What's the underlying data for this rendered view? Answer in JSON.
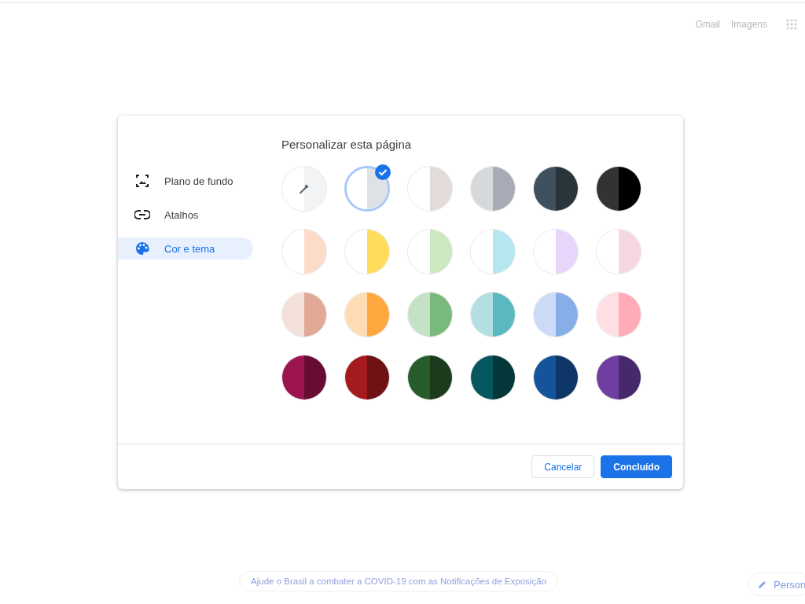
{
  "top_links": [
    "Gmail",
    "Imagens"
  ],
  "dialog": {
    "sidebar": [
      {
        "label": "Plano de fundo",
        "selected": false
      },
      {
        "label": "Atalhos",
        "selected": false
      },
      {
        "label": "Cor e tema",
        "selected": true
      }
    ],
    "title": "Personalizar esta página",
    "swatches": [
      {
        "kind": "picker",
        "halves": [
          {
            "color": "#ffffff"
          },
          {
            "color": "#f1f3f4"
          }
        ],
        "selected": false
      },
      {
        "kind": "swatch",
        "halves": [
          {
            "color": "#ffffff"
          },
          {
            "color": "#dee1e5"
          }
        ],
        "selected": true
      },
      {
        "kind": "swatch",
        "halves": [
          {
            "color": "#ffffff"
          },
          {
            "color": "#e3dcd9"
          }
        ],
        "selected": false
      },
      {
        "kind": "swatch",
        "halves": [
          {
            "color": "#d6d8dc"
          },
          {
            "color": "#a8abb5"
          }
        ],
        "selected": false
      },
      {
        "kind": "swatch",
        "halves": [
          {
            "color": "#3f515c"
          },
          {
            "color": "#29343b"
          }
        ],
        "selected": false
      },
      {
        "kind": "swatch",
        "halves": [
          {
            "color": "#333333"
          },
          {
            "color": "#000000"
          }
        ],
        "selected": false
      },
      {
        "kind": "swatch",
        "halves": [
          {
            "color": "#ffffff"
          },
          {
            "color": "#fcdbc9"
          }
        ],
        "selected": false
      },
      {
        "kind": "swatch",
        "halves": [
          {
            "color": "#ffffff"
          },
          {
            "color": "#ffdd5c"
          }
        ],
        "selected": false
      },
      {
        "kind": "swatch",
        "halves": [
          {
            "color": "#ffffff"
          },
          {
            "color": "#cce8c1"
          }
        ],
        "selected": false
      },
      {
        "kind": "swatch",
        "halves": [
          {
            "color": "#ffffff"
          },
          {
            "color": "#b5e7f0"
          }
        ],
        "selected": false
      },
      {
        "kind": "swatch",
        "halves": [
          {
            "color": "#ffffff"
          },
          {
            "color": "#e7d5fb"
          }
        ],
        "selected": false
      },
      {
        "kind": "swatch",
        "halves": [
          {
            "color": "#ffffff"
          },
          {
            "color": "#f6d6e2"
          }
        ],
        "selected": false
      },
      {
        "kind": "swatch",
        "halves": [
          {
            "color": "#f3e0da"
          },
          {
            "color": "#e2a997"
          }
        ],
        "selected": false
      },
      {
        "kind": "swatch",
        "halves": [
          {
            "color": "#ffdcb4"
          },
          {
            "color": "#ffa83f"
          }
        ],
        "selected": false
      },
      {
        "kind": "swatch",
        "halves": [
          {
            "color": "#c5e2c6"
          },
          {
            "color": "#79ba7c"
          }
        ],
        "selected": false
      },
      {
        "kind": "swatch",
        "halves": [
          {
            "color": "#b4dfe2"
          },
          {
            "color": "#5bb8bf"
          }
        ],
        "selected": false
      },
      {
        "kind": "swatch",
        "halves": [
          {
            "color": "#cadaf7"
          },
          {
            "color": "#86aee9"
          }
        ],
        "selected": false
      },
      {
        "kind": "swatch",
        "halves": [
          {
            "color": "#ffdfe4"
          },
          {
            "color": "#ffacb8"
          }
        ],
        "selected": false
      },
      {
        "kind": "swatch",
        "halves": [
          {
            "color": "#9d154f"
          },
          {
            "color": "#690c33"
          }
        ],
        "selected": false
      },
      {
        "kind": "swatch",
        "halves": [
          {
            "color": "#a51b1d"
          },
          {
            "color": "#6f1213"
          }
        ],
        "selected": false
      },
      {
        "kind": "swatch",
        "halves": [
          {
            "color": "#265d2b"
          },
          {
            "color": "#1b3b1c"
          }
        ],
        "selected": false
      },
      {
        "kind": "swatch",
        "halves": [
          {
            "color": "#05595e"
          },
          {
            "color": "#04363a"
          }
        ],
        "selected": false
      },
      {
        "kind": "swatch",
        "halves": [
          {
            "color": "#15539a"
          },
          {
            "color": "#0e3666"
          }
        ],
        "selected": false
      },
      {
        "kind": "swatch",
        "halves": [
          {
            "color": "#6e3fa1"
          },
          {
            "color": "#45296b"
          }
        ],
        "selected": false
      }
    ],
    "buttons": [
      {
        "label": "Cancelar",
        "kind": "secondary"
      },
      {
        "label": "Concluído",
        "kind": "primary"
      }
    ]
  },
  "notice": "Ajude o Brasil a combater a COVID-19 com as Notificações de Exposição",
  "customize_button": "Person"
}
